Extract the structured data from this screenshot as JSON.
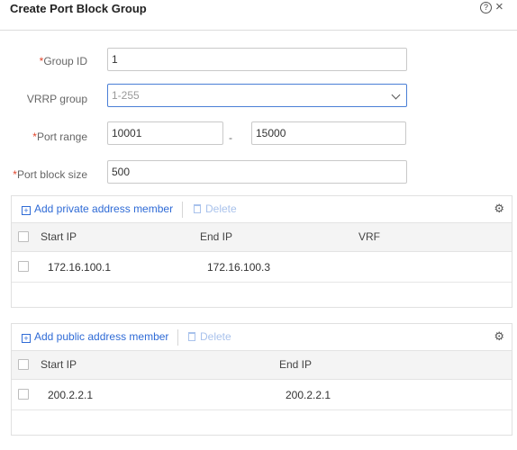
{
  "dialog": {
    "title": "Create Port Block Group",
    "help_glyph": "?",
    "close_glyph": "×"
  },
  "form": {
    "required_mark": "*",
    "group_id": {
      "label": "Group ID",
      "value": "1"
    },
    "vrrp_group": {
      "label": "VRRP group",
      "placeholder": "1-255"
    },
    "port_range": {
      "label": "Port range",
      "start": "10001",
      "separator": "-",
      "end": "15000"
    },
    "port_block_size": {
      "label": "Port block size",
      "value": "500"
    }
  },
  "private_table": {
    "add_label": "Add private address member",
    "delete_label": "Delete",
    "columns": [
      "Start IP",
      "End IP",
      "VRF"
    ],
    "rows": [
      {
        "start_ip": "172.16.100.1",
        "end_ip": "172.16.100.3",
        "vrf": ""
      }
    ]
  },
  "public_table": {
    "add_label": "Add public address member",
    "delete_label": "Delete",
    "columns": [
      "Start IP",
      "End IP"
    ],
    "rows": [
      {
        "start_ip": "200.2.2.1",
        "end_ip": "200.2.2.1"
      }
    ]
  },
  "icons": {
    "plus": "+",
    "gear": "⚙"
  },
  "colors": {
    "accent": "#2f6bd6",
    "required": "#e0452c",
    "disabled_link": "#a9c2ec"
  }
}
